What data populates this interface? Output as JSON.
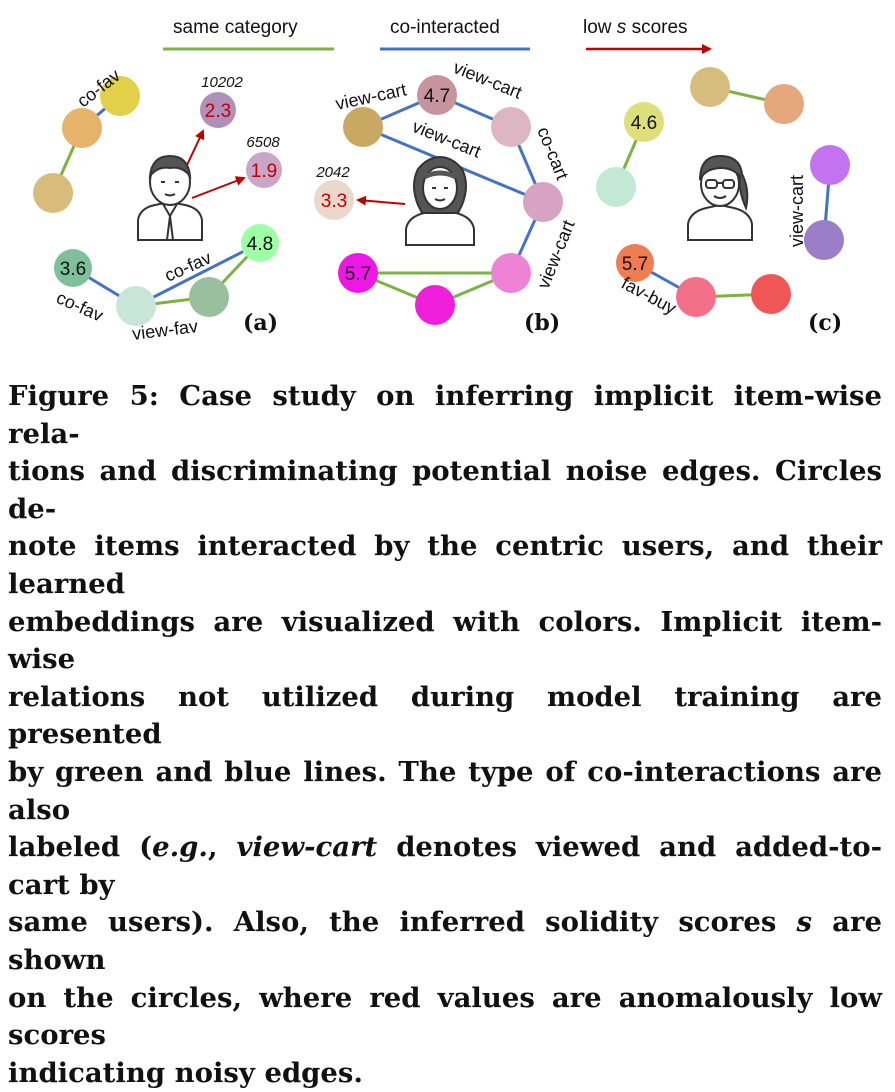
{
  "legend": {
    "same_category": "same category",
    "co_interacted": "co-interacted",
    "low_s_prefix": "low ",
    "low_s_var": "s",
    "low_s_suffix": " scores",
    "colors": {
      "same_category": "#7cb342",
      "co_interacted": "#4472c4",
      "low_scores": "#c00000"
    }
  },
  "panels": {
    "a": {
      "label": "(a)",
      "edge_labels": [
        "co-fav",
        "co-fav",
        "co-fav",
        "view-fav"
      ],
      "scores": {
        "s36": "3.6",
        "s48": "4.8",
        "noisy1": "2.3",
        "noisy2": "1.9"
      },
      "item_ids": {
        "id1": "10202",
        "id2": "6508"
      }
    },
    "b": {
      "label": "(b)",
      "edge_labels": [
        "view-cart",
        "view-cart",
        "view-cart",
        "co-cart",
        "view-cart"
      ],
      "scores": {
        "s47": "4.7",
        "s57": "5.7",
        "noisy": "3.3"
      },
      "item_ids": {
        "id1": "2042"
      }
    },
    "c": {
      "label": "(c)",
      "edge_labels": [
        "view-cart",
        "fav-buy"
      ],
      "scores": {
        "s46": "4.6",
        "s57": "5.7"
      }
    }
  },
  "caption": {
    "l1": "Figure 5: Case study on inferring implicit item-wise rela-",
    "l2": "tions and discriminating potential noise edges. Circles de-",
    "l3": "note items interacted by the centric users, and their learned",
    "l4": "embeddings are visualized with colors. Implicit item-wise",
    "l5": "relations not utilized during model training are presented",
    "l6": "by green and blue lines. The type of co-interactions are also",
    "l7_a": "labeled (",
    "l7_eg": "e.g.",
    "l7_b": ", ",
    "l7_vc": "view-cart",
    "l7_c": " denotes viewed and added-to-cart by",
    "l8": "same users). Also, the inferred solidity scores ",
    "l8_s": "s",
    "l8_b": " are shown",
    "l9": "on the circles, where red values are anomalously low scores",
    "l10": "indicating noisy edges."
  }
}
